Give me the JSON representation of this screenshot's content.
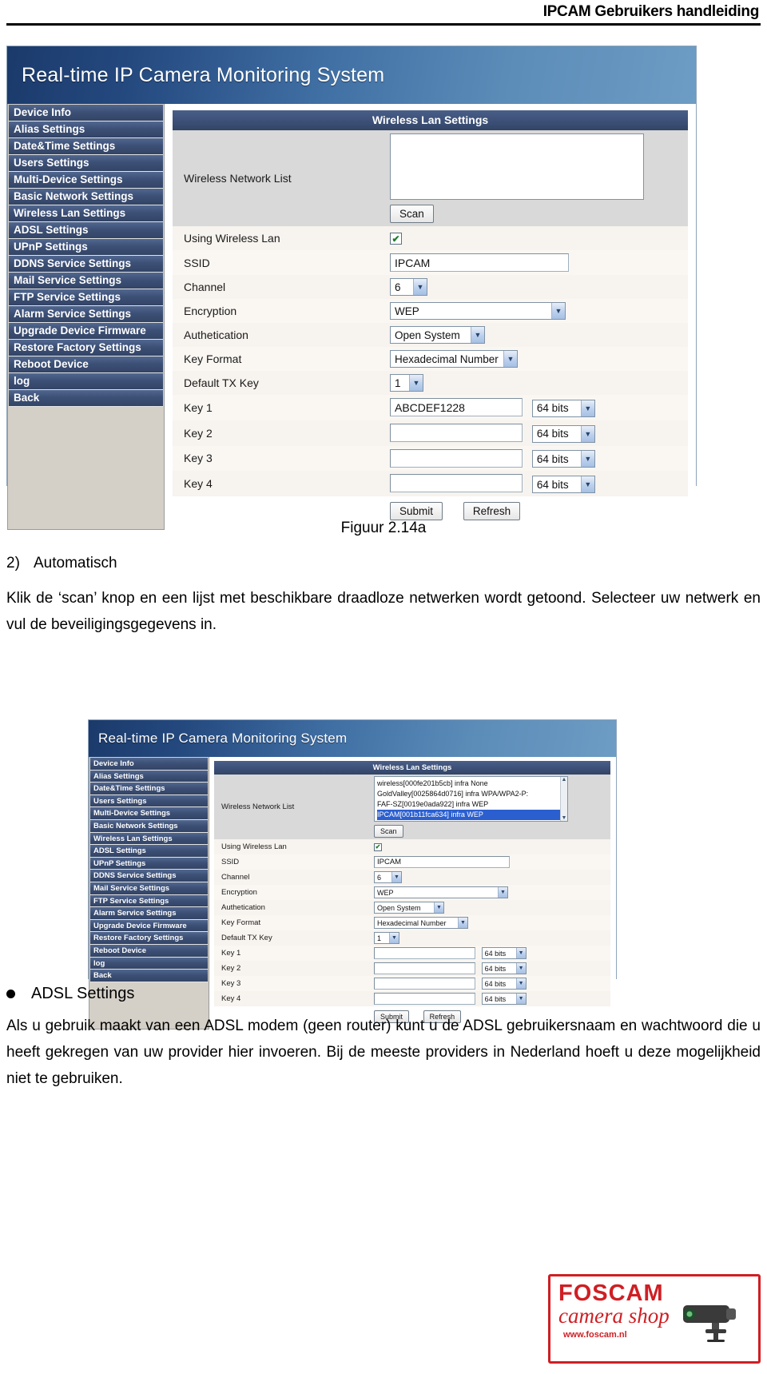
{
  "document": {
    "header_title": "IPCAM Gebruikers handleiding",
    "figure_caption": "Figuur 2.14a",
    "step_number": "2)",
    "step_title": "Automatisch",
    "paragraph_1": "Klik de ‘scan’ knop en een lijst met beschikbare draadloze netwerken wordt getoond. Selecteer uw netwerk en vul de beveiligingsgegevens in.",
    "bullet_heading": "ADSL Settings",
    "paragraph_2": "Als u gebruik maakt van een ADSL modem (geen router) kunt u de ADSL gebruikersnaam en wachtwoord die u heeft gekregen van uw provider hier invoeren. Bij de meeste providers in Nederland hoeft u deze mogelijkheid niet te gebruiken."
  },
  "camera_ui": {
    "banner_title": "Real-time IP Camera Monitoring System",
    "panel_title": "Wireless Lan Settings",
    "sidebar_items": [
      {
        "label": "Device Info"
      },
      {
        "label": "Alias Settings"
      },
      {
        "label": "Date&Time Settings"
      },
      {
        "label": "Users Settings"
      },
      {
        "label": "Multi-Device Settings"
      },
      {
        "label": "Basic Network Settings"
      },
      {
        "label": "Wireless Lan Settings"
      },
      {
        "label": "ADSL Settings"
      },
      {
        "label": "UPnP Settings"
      },
      {
        "label": "DDNS Service Settings"
      },
      {
        "label": "Mail Service Settings"
      },
      {
        "label": "FTP Service Settings"
      },
      {
        "label": "Alarm Service Settings"
      },
      {
        "label": "Upgrade Device Firmware"
      },
      {
        "label": "Restore Factory Settings"
      },
      {
        "label": "Reboot Device"
      },
      {
        "label": "log"
      },
      {
        "label": "Back"
      }
    ],
    "labels": {
      "wireless_network_list": "Wireless Network List",
      "using_wireless_lan": "Using Wireless Lan",
      "ssid": "SSID",
      "channel": "Channel",
      "encryption": "Encryption",
      "authetication": "Authetication",
      "key_format": "Key Format",
      "default_tx_key": "Default TX Key",
      "key_1": "Key 1",
      "key_2": "Key 2",
      "key_3": "Key 3",
      "key_4": "Key 4"
    },
    "buttons": {
      "scan": "Scan",
      "submit": "Submit",
      "refresh": "Refresh"
    },
    "figure_a": {
      "network_list": [],
      "using_wireless_lan_checked": "✔",
      "ssid_value": "IPCAM",
      "channel_value": "6",
      "encryption_value": "WEP",
      "authetication_value": "Open System",
      "key_format_value": "Hexadecimal Number",
      "default_tx_key_value": "1",
      "key_1_value": "ABCDEF1228",
      "key_2_value": "",
      "key_3_value": "",
      "key_4_value": "",
      "key_1_bits": "64 bits",
      "key_2_bits": "64 bits",
      "key_3_bits": "64 bits",
      "key_4_bits": "64 bits"
    },
    "figure_b": {
      "network_list": [
        "wireless[000fe201b5cb] infra None",
        "GoldValley[0025864d0716] infra WPA/WPA2-P:",
        "FAF-SZ[0019e0ada922] infra WEP",
        "IPCAM[001b11fca634] infra WEP"
      ],
      "network_list_selected_index": 3,
      "using_wireless_lan_checked": "✔",
      "ssid_value": "IPCAM",
      "channel_value": "6",
      "encryption_value": "WEP",
      "authetication_value": "Open System",
      "key_format_value": "Hexadecimal Number",
      "default_tx_key_value": "1",
      "key_1_value": "",
      "key_2_value": "",
      "key_3_value": "",
      "key_4_value": "",
      "key_1_bits": "64 bits",
      "key_2_bits": "64 bits",
      "key_3_bits": "64 bits",
      "key_4_bits": "64 bits"
    }
  },
  "logo": {
    "line1": "FOSCAM",
    "line2": "camera shop",
    "url": "www.foscam.nl",
    "brand_color": "#cf1f24"
  }
}
